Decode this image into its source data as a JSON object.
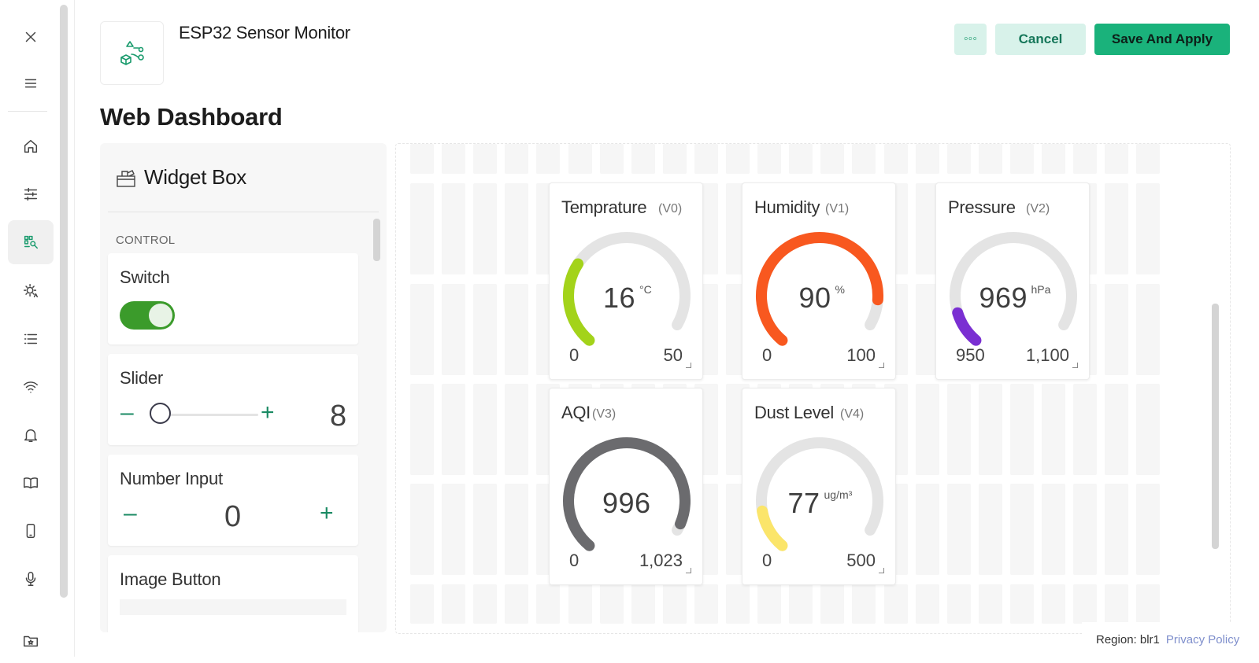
{
  "header": {
    "project_name": "ESP32 Sensor Monitor",
    "more_label": "◦◦◦",
    "cancel_label": "Cancel",
    "save_label": "Save And Apply"
  },
  "page": {
    "title": "Web Dashboard"
  },
  "sidebar": {
    "items": [
      {
        "icon": "close-icon"
      },
      {
        "icon": "menu-icon"
      },
      {
        "icon": "home-icon"
      },
      {
        "icon": "sliders-icon"
      },
      {
        "icon": "dashboard-icon",
        "active": true
      },
      {
        "icon": "automation-icon"
      },
      {
        "icon": "list-icon"
      },
      {
        "icon": "wifi-icon"
      },
      {
        "icon": "bell-icon"
      },
      {
        "icon": "book-icon"
      },
      {
        "icon": "mobile-icon"
      },
      {
        "icon": "mic-icon"
      },
      {
        "icon": "folder-icon"
      }
    ]
  },
  "widget_box": {
    "title": "Widget Box",
    "section": "CONTROL",
    "switch": {
      "label": "Switch",
      "on": true
    },
    "slider": {
      "label": "Slider",
      "minus": "–",
      "plus": "+",
      "value": "8"
    },
    "number_input": {
      "label": "Number Input",
      "minus": "–",
      "plus": "+",
      "value": "0"
    },
    "image_button": {
      "label": "Image Button"
    }
  },
  "gauges": [
    {
      "title": "Temprature",
      "pin": "(V0)",
      "value": "16",
      "unit": "°C",
      "min": "0",
      "max": "50",
      "raw": 16,
      "lo": 0,
      "hi": 50,
      "color": "#a3d31a"
    },
    {
      "title": "Humidity",
      "pin": "(V1)",
      "value": "90",
      "unit": "%",
      "min": "0",
      "max": "100",
      "raw": 90,
      "lo": 0,
      "hi": 100,
      "color": "#f8581f"
    },
    {
      "title": "Pressure",
      "pin": "(V2)",
      "value": "969",
      "unit": "hPa",
      "min": "950",
      "max": "1,100",
      "raw": 969,
      "lo": 950,
      "hi": 1100,
      "color": "#7a2fd2"
    },
    {
      "title": "AQI",
      "pin": "(V3)",
      "value": "996",
      "unit": "",
      "min": "0",
      "max": "1,023",
      "raw": 996,
      "lo": 0,
      "hi": 1023,
      "color": "#6b6b6e"
    },
    {
      "title": "Dust Level",
      "pin": "(V4)",
      "value": "77",
      "unit": "ug/m³",
      "min": "0",
      "max": "500",
      "raw": 77,
      "lo": 0,
      "hi": 500,
      "color": "#fbe56a"
    }
  ],
  "footer": {
    "region": "Region: blr1",
    "privacy": "Privacy Policy"
  }
}
